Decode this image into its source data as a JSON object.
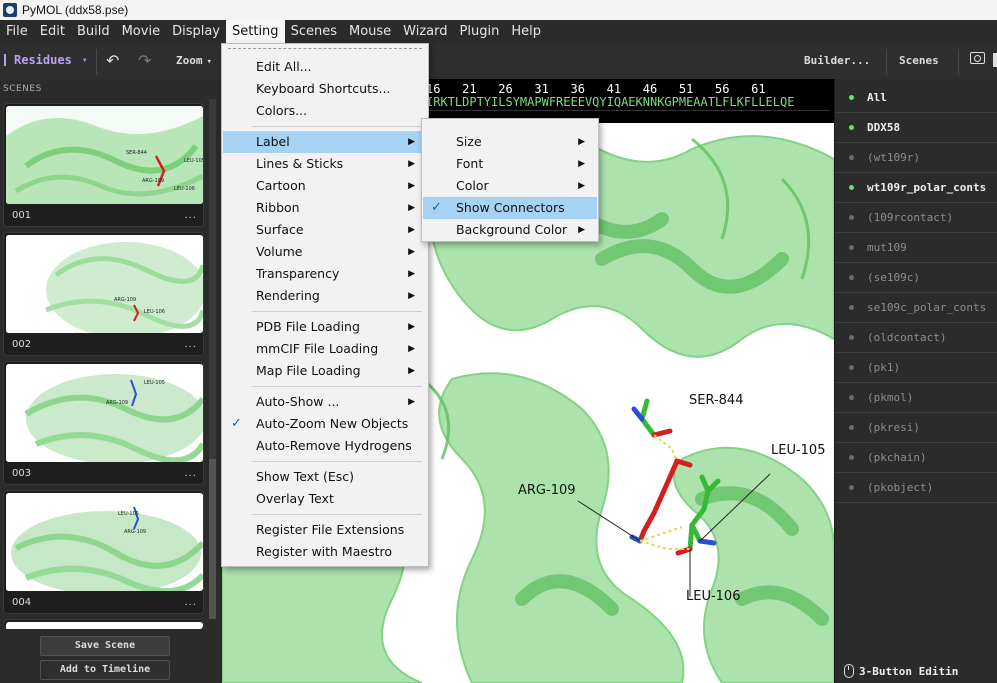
{
  "window": {
    "title": "PyMOL (ddx58.pse)"
  },
  "menubar": [
    "File",
    "Edit",
    "Build",
    "Movie",
    "Display",
    "Setting",
    "Scenes",
    "Mouse",
    "Wizard",
    "Plugin",
    "Help"
  ],
  "toolbar": {
    "selection_mode": "Residues",
    "undo": "↶",
    "redo": "↷",
    "zoom": "Zoom",
    "builder": "Builder...",
    "scenes": "Scenes"
  },
  "scenes_panel": {
    "header": "SCENES",
    "scenes": [
      {
        "label": "001",
        "more": "..."
      },
      {
        "label": "002",
        "more": "..."
      },
      {
        "label": "003",
        "more": "..."
      },
      {
        "label": "004",
        "more": "..."
      }
    ],
    "save_scene": "Save Scene",
    "add_to_timeline": "Add to Timeline"
  },
  "sequence": {
    "numbers": "16   21   26   31   36   41   46   51   56   61",
    "residues": "IRKTLDPTYILSYMAPWFREEEVQYIQAEKNNKGPMEAATLFLKFLLELQE"
  },
  "viewport_labels": {
    "ser844": "SER-844",
    "leu105": "LEU-105",
    "arg109": "ARG-109",
    "leu106": "LEU-106"
  },
  "objects": [
    {
      "name": "All",
      "enabled": true,
      "style": "bold"
    },
    {
      "name": "DDX58",
      "enabled": true,
      "style": "bold"
    },
    {
      "name": "(wt109r)",
      "enabled": false,
      "style": "dim"
    },
    {
      "name": "wt109r_polar_conts",
      "enabled": true,
      "style": "bold"
    },
    {
      "name": "(109rcontact)",
      "enabled": false,
      "style": "dim"
    },
    {
      "name": "mut109",
      "enabled": false,
      "style": "dim"
    },
    {
      "name": "(se109c)",
      "enabled": false,
      "style": "dim"
    },
    {
      "name": "se109c_polar_conts",
      "enabled": false,
      "style": "dim"
    },
    {
      "name": "(oldcontact)",
      "enabled": false,
      "style": "dim"
    },
    {
      "name": "(pk1)",
      "enabled": false,
      "style": "dim"
    },
    {
      "name": "(pkmol)",
      "enabled": false,
      "style": "dim"
    },
    {
      "name": "(pkresi)",
      "enabled": false,
      "style": "dim"
    },
    {
      "name": "(pkchain)",
      "enabled": false,
      "style": "dim"
    },
    {
      "name": "(pkobject)",
      "enabled": false,
      "style": "dim"
    }
  ],
  "mouse_mode": "3-Button Editin",
  "setting_menu": {
    "items": [
      {
        "label": "Edit All..."
      },
      {
        "label": "Keyboard Shortcuts..."
      },
      {
        "label": "Colors..."
      },
      {
        "label": "Label",
        "submenu": true,
        "highlighted": true
      },
      {
        "label": "Lines & Sticks",
        "submenu": true
      },
      {
        "label": "Cartoon",
        "submenu": true
      },
      {
        "label": "Ribbon",
        "submenu": true
      },
      {
        "label": "Surface",
        "submenu": true
      },
      {
        "label": "Volume",
        "submenu": true
      },
      {
        "label": "Transparency",
        "submenu": true
      },
      {
        "label": "Rendering",
        "submenu": true
      },
      {
        "label": "PDB File Loading",
        "submenu": true
      },
      {
        "label": "mmCIF File Loading",
        "submenu": true
      },
      {
        "label": "Map File Loading",
        "submenu": true
      },
      {
        "label": "Auto-Show ...",
        "submenu": true
      },
      {
        "label": "Auto-Zoom New Objects",
        "checked": true
      },
      {
        "label": "Auto-Remove Hydrogens"
      },
      {
        "label": "Show Text (Esc)"
      },
      {
        "label": "Overlay Text"
      },
      {
        "label": "Register File Extensions"
      },
      {
        "label": "Register with Maestro"
      }
    ]
  },
  "label_submenu": {
    "items": [
      {
        "label": "Size",
        "submenu": true
      },
      {
        "label": "Font",
        "submenu": true
      },
      {
        "label": "Color",
        "submenu": true
      },
      {
        "label": "Show Connectors",
        "checked": true,
        "highlighted": true
      },
      {
        "label": "Background Color",
        "submenu": true
      }
    ]
  },
  "colors": {
    "cartoon": "#92d892",
    "highlight": "#a6d2f4",
    "arg_stick": "#d41f1f"
  }
}
